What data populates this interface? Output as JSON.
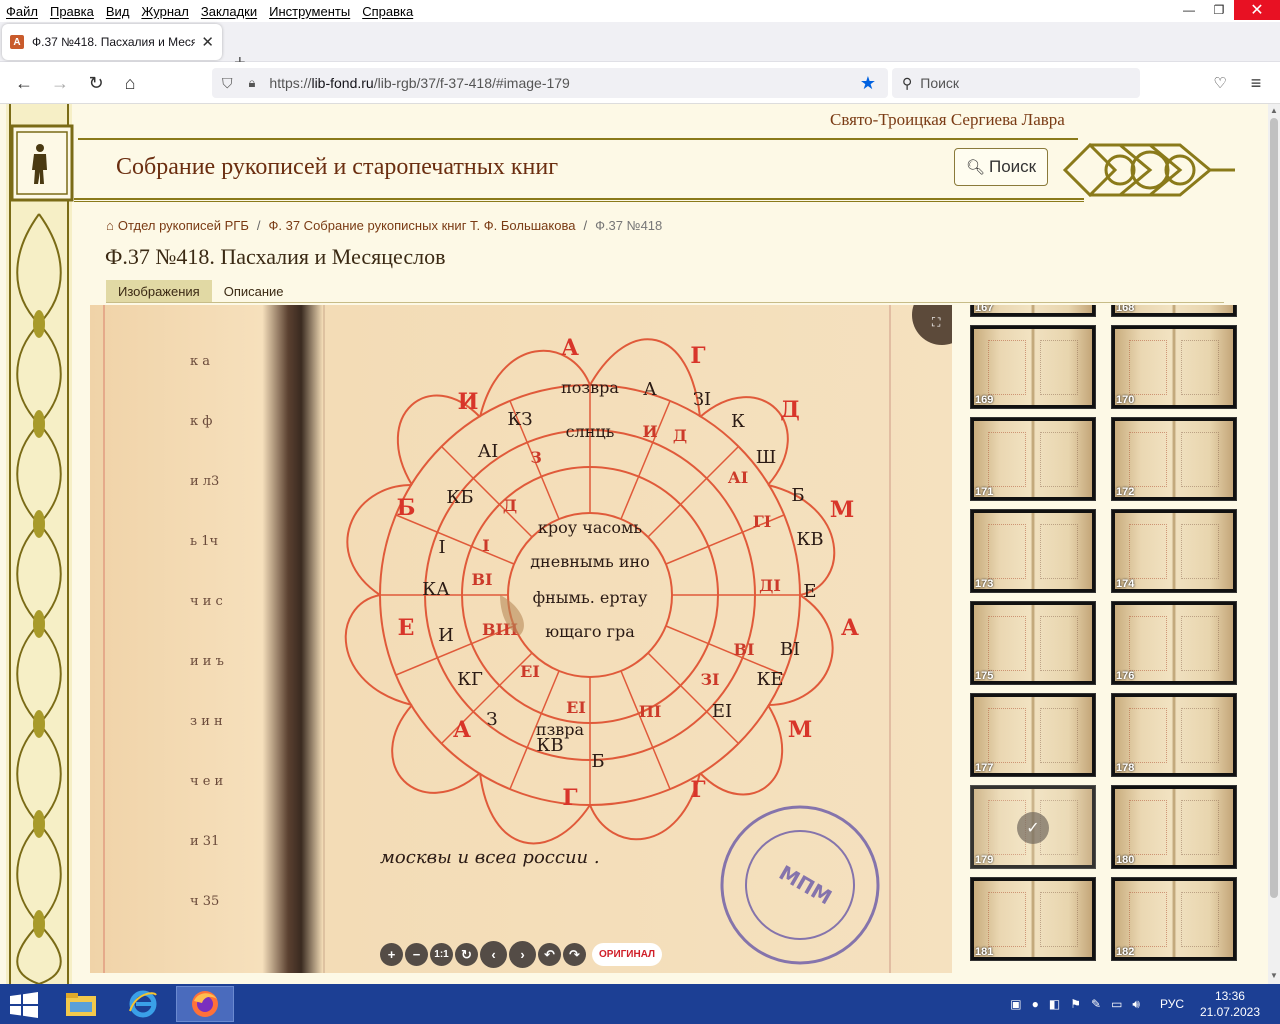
{
  "menubar": {
    "items": [
      "Файл",
      "Правка",
      "Вид",
      "Журнал",
      "Закладки",
      "Инструменты",
      "Справка"
    ]
  },
  "tab": {
    "title": "Ф.37 №418. Пасхалия и Месяцесл"
  },
  "url": {
    "prefix": "https://",
    "domain": "lib-fond.ru",
    "path": "/lib-rgb/37/f-37-418/#image-179"
  },
  "search": {
    "placeholder": "Поиск"
  },
  "site": {
    "lavra": "Свято-Троицкая Сергиева Лавра",
    "title": "Собрание рукописей и старопечатных книг",
    "search_button": "Поиск"
  },
  "breadcrumb": {
    "items": [
      "Отдел рукописей РГБ",
      "Ф. 37 Собрание рукописных книг Т. Ф. Большакова",
      "Ф.37 №418"
    ]
  },
  "book_title": "Ф.37 №418. Пасхалия и Месяцеслов",
  "content_tabs": [
    "Изображения",
    "Описание"
  ],
  "viewer": {
    "controls": [
      "+",
      "−",
      "1:1",
      "↻",
      "‹",
      "›",
      "↶",
      "↷"
    ],
    "original_label": "ОРИГИНАЛ",
    "manuscript_caption": "москвы и всеа россии ."
  },
  "thumbnails": [
    "167",
    "168",
    "169",
    "170",
    "171",
    "172",
    "173",
    "174",
    "175",
    "176",
    "177",
    "178",
    "179",
    "180",
    "181",
    "182"
  ],
  "selected_thumbnail": "179",
  "taskbar": {
    "lang": "РУС",
    "time": "13:36",
    "date": "21.07.2023"
  },
  "colors": {
    "accent_brown": "#7a3b14",
    "page_bg": "#fdf9e6",
    "taskbar": "#1c3f94"
  }
}
